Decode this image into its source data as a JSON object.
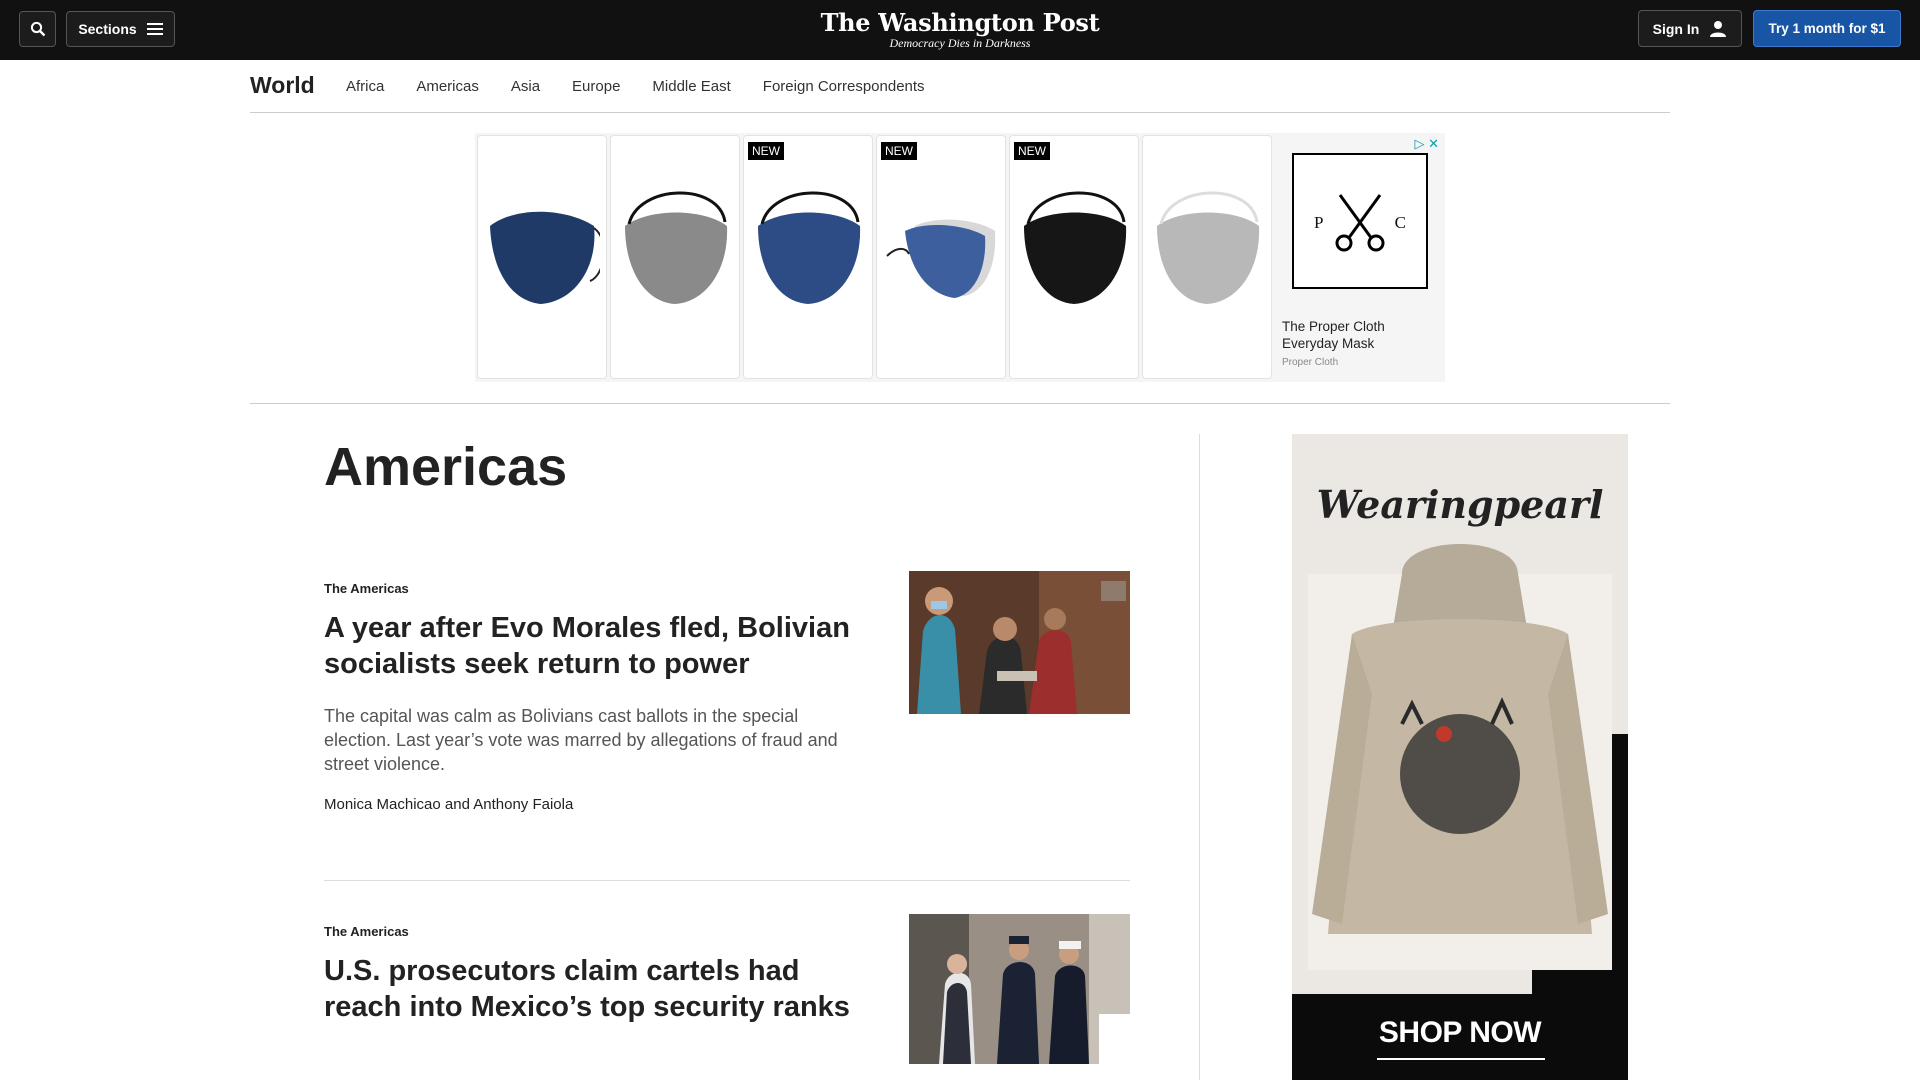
{
  "header": {
    "logo": "The Washington Post",
    "tagline": "Democracy Dies in Darkness",
    "sections_label": "Sections",
    "signin_label": "Sign In",
    "subscribe_label": "Try 1 month for $1"
  },
  "subnav": {
    "section": "World",
    "links": [
      "Africa",
      "Americas",
      "Asia",
      "Europe",
      "Middle East",
      "Foreign Correspondents"
    ]
  },
  "banner_ad": {
    "new_badge": "NEW",
    "logo_left": "P",
    "logo_right": "C",
    "title": "The Proper Cloth Everyday Mask",
    "brand": "Proper Cloth"
  },
  "page": {
    "title": "Americas"
  },
  "stories": [
    {
      "kicker": "The Americas",
      "headline": "A year after Evo Morales fled, Bolivian socialists seek return to power",
      "blurb": "The capital was calm as Bolivians cast ballots in the special election. Last year’s vote was marred by allegations of fraud and street violence.",
      "byline": "Monica Machicao and Anthony Faiola"
    },
    {
      "kicker": "The Americas",
      "headline": "U.S. prosecutors claim cartels had reach into Mexico’s top security ranks"
    }
  ],
  "side_ad": {
    "brand": "Wearingpearl",
    "cta": "SHOP NOW"
  }
}
